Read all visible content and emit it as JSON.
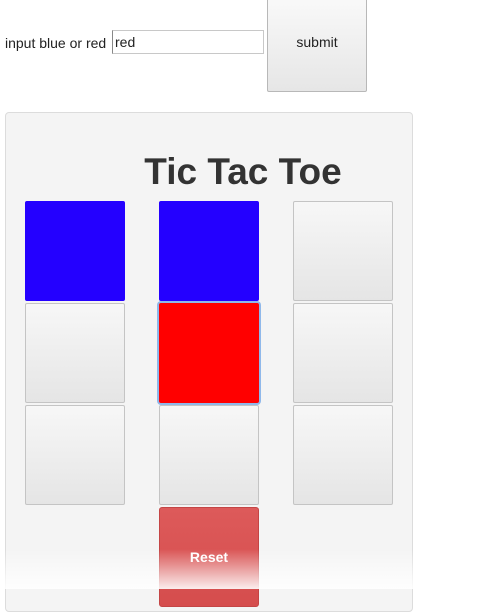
{
  "form": {
    "label": "input blue or red",
    "input_value": "red",
    "submit_label": "submit"
  },
  "game": {
    "title": "Tic Tac Toe",
    "reset_label": "Reset",
    "cells": [
      "blue",
      "blue",
      "",
      "",
      "red",
      "",
      "",
      "",
      ""
    ],
    "focused_cell": 4
  },
  "colors": {
    "blue": "#2400ff",
    "red": "#ff0000",
    "reset_button": "#d9534f"
  }
}
